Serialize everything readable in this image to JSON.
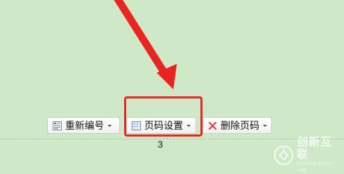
{
  "toolbar": {
    "renumber": {
      "label": "重新编号",
      "icon": "renumber-icon"
    },
    "page_setup": {
      "label": "页码设置",
      "icon": "page-setup-icon"
    },
    "delete": {
      "label": "删除页码",
      "icon": "delete-x-icon"
    }
  },
  "footer": {
    "page_number": "3"
  },
  "annotation": {
    "arrow_color": "#e8251f",
    "highlight_color": "#e8251f"
  },
  "watermark": {
    "cn": "创新互联",
    "en": "CHUANG XIN HU LIAN"
  },
  "colors": {
    "background": "#cfe8c8",
    "delete_icon": "#e23b3b"
  }
}
